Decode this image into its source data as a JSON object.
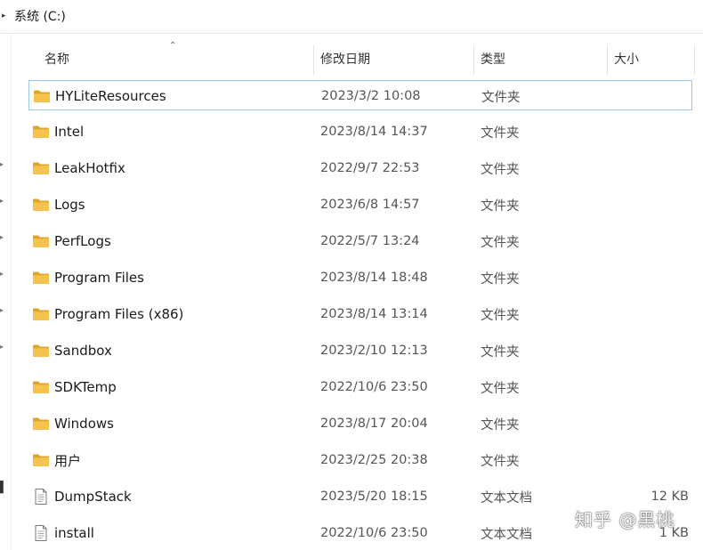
{
  "breadcrumb": {
    "location": "系统 (C:)"
  },
  "columns": {
    "name": "名称",
    "modified": "修改日期",
    "type": "类型",
    "size": "大小"
  },
  "files": [
    {
      "name": "HYLiteResources",
      "modified": "2023/3/2 10:08",
      "type": "文件夹",
      "size": "",
      "icon": "folder-icon"
    },
    {
      "name": "Intel",
      "modified": "2023/8/14 14:37",
      "type": "文件夹",
      "size": "",
      "icon": "folder-icon"
    },
    {
      "name": "LeakHotfix",
      "modified": "2022/9/7 22:53",
      "type": "文件夹",
      "size": "",
      "icon": "folder-icon"
    },
    {
      "name": "Logs",
      "modified": "2023/6/8 14:57",
      "type": "文件夹",
      "size": "",
      "icon": "folder-icon"
    },
    {
      "name": "PerfLogs",
      "modified": "2022/5/7 13:24",
      "type": "文件夹",
      "size": "",
      "icon": "folder-icon"
    },
    {
      "name": "Program Files",
      "modified": "2023/8/14 18:48",
      "type": "文件夹",
      "size": "",
      "icon": "folder-icon"
    },
    {
      "name": "Program Files (x86)",
      "modified": "2023/8/14 13:14",
      "type": "文件夹",
      "size": "",
      "icon": "folder-icon"
    },
    {
      "name": "Sandbox",
      "modified": "2023/2/10 12:13",
      "type": "文件夹",
      "size": "",
      "icon": "folder-icon"
    },
    {
      "name": "SDKTemp",
      "modified": "2022/10/6 23:50",
      "type": "文件夹",
      "size": "",
      "icon": "folder-icon"
    },
    {
      "name": "Windows",
      "modified": "2023/8/17 20:04",
      "type": "文件夹",
      "size": "",
      "icon": "folder-icon"
    },
    {
      "name": "用户",
      "modified": "2023/2/25 20:38",
      "type": "文件夹",
      "size": "",
      "icon": "folder-icon"
    },
    {
      "name": "DumpStack",
      "modified": "2023/5/20 18:15",
      "type": "文本文档",
      "size": "12 KB",
      "icon": "text-document-icon"
    },
    {
      "name": "install",
      "modified": "2022/10/6 23:50",
      "type": "文本文档",
      "size": "1 KB",
      "icon": "text-document-icon"
    }
  ],
  "selected_index": 0,
  "watermark": "知乎 @黑桃",
  "colors": {
    "folder": "#f4c24f",
    "folder_dark": "#e0a526",
    "selection_border": "#99c9ef"
  }
}
